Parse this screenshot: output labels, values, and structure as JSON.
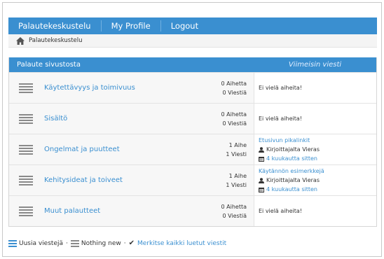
{
  "nav": {
    "items": [
      {
        "label": "Palautekeskustelu"
      },
      {
        "label": "My Profile"
      },
      {
        "label": "Logout"
      }
    ]
  },
  "breadcrumb": {
    "label": "Palautekeskustelu"
  },
  "forum": {
    "header": {
      "title": "Palaute sivustosta",
      "last_post": "Viimeisin viesti"
    },
    "rows": [
      {
        "title": "Käytettävyys ja toimivuus",
        "topics": "0 Aihetta",
        "posts": "0 Viestiä",
        "empty_text": "Ei vielä aiheita!"
      },
      {
        "title": "Sisältö",
        "topics": "0 Aihetta",
        "posts": "0 Viestiä",
        "empty_text": "Ei vielä aiheita!"
      },
      {
        "title": "Ongelmat ja puutteet",
        "topics": "1 Aihe",
        "posts": "1 Viesti",
        "last_topic": "Etusivun pikalinkit",
        "last_author": "Kirjoittajalta Vieras",
        "last_time": "4 kuukautta sitten"
      },
      {
        "title": "Kehitysideat ja toiveet",
        "topics": "1 Aihe",
        "posts": "1 Viesti",
        "last_topic": "Käytännön esimerkkejä",
        "last_author": "Kirjoittajalta Vieras",
        "last_time": "4 kuukautta sitten"
      },
      {
        "title": "Muut palautteet",
        "topics": "0 Aihetta",
        "posts": "0 Viestiä",
        "empty_text": "Ei vielä aiheita!"
      }
    ]
  },
  "legend": {
    "new_posts": "Uusia viestejä",
    "separator": "·",
    "nothing_new": "Nothing new",
    "mark_all_read": "Merkitse kaikki luetut viestit"
  },
  "colors": {
    "accent": "#3a8fd0",
    "icon_gray": "#8a8a8a"
  },
  "icons": [
    "home-icon",
    "forum-list-icon",
    "user-icon",
    "calendar-icon",
    "checkmark-icon"
  ]
}
